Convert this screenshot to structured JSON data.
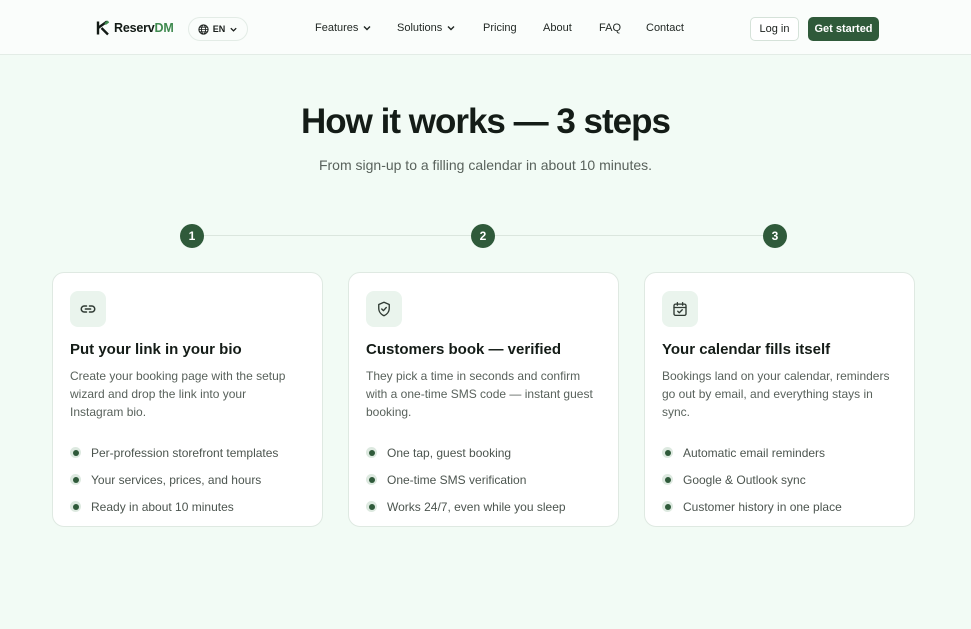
{
  "brand": {
    "name_main": "Reserv",
    "name_accent": "DM",
    "accent_color": "#3f8a4f",
    "primary_color": "#2f5a3a"
  },
  "language": {
    "code": "EN"
  },
  "nav": {
    "items": [
      {
        "label": "Features",
        "has_dropdown": true
      },
      {
        "label": "Solutions",
        "has_dropdown": true
      },
      {
        "label": "Pricing",
        "has_dropdown": false
      },
      {
        "label": "About",
        "has_dropdown": false
      },
      {
        "label": "FAQ",
        "has_dropdown": false
      },
      {
        "label": "Contact",
        "has_dropdown": false
      }
    ],
    "login_label": "Log in",
    "cta_label": "Get started"
  },
  "hero": {
    "title": "How it works — 3 steps",
    "subtitle": "From sign-up to a filling calendar in about 10 minutes."
  },
  "steps": [
    {
      "number": "1",
      "icon": "link-icon",
      "title": "Put your link in your bio",
      "description": "Create your booking page with the setup wizard and drop the link into your Instagram bio.",
      "features": [
        "Per-profession storefront templates",
        "Your services, prices, and hours",
        "Ready in about 10 minutes"
      ]
    },
    {
      "number": "2",
      "icon": "shield-check-icon",
      "title": "Customers book — verified",
      "description": "They pick a time in seconds and confirm with a one-time SMS code — instant guest booking.",
      "features": [
        "One tap, guest booking",
        "One-time SMS verification",
        "Works 24/7, even while you sleep"
      ]
    },
    {
      "number": "3",
      "icon": "calendar-check-icon",
      "title": "Your calendar fills itself",
      "description": "Bookings land on your calendar, reminders go out by email, and everything stays in sync.",
      "features": [
        "Automatic email reminders",
        "Google & Outlook sync",
        "Customer history in one place"
      ]
    }
  ]
}
